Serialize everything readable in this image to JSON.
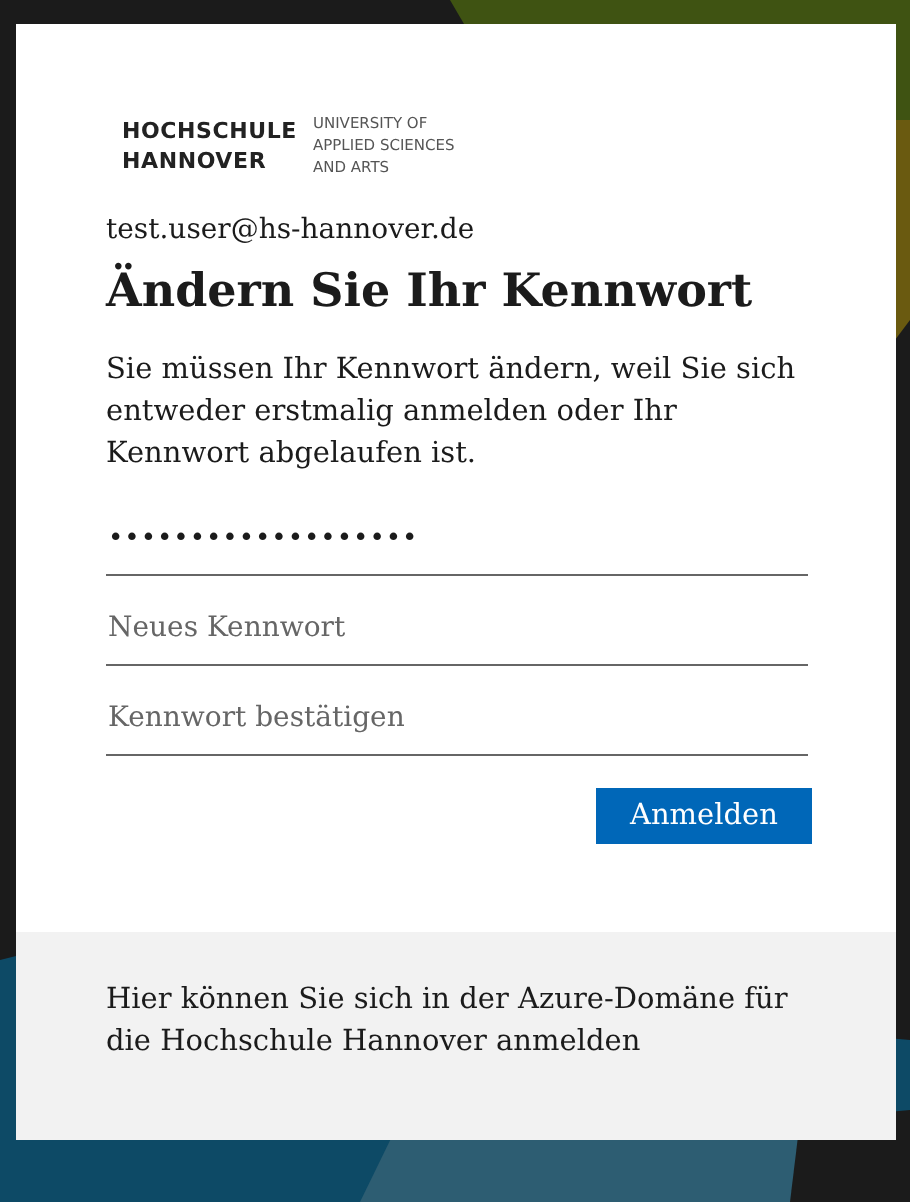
{
  "logo": {
    "name_lines": [
      "HOCHSCHULE",
      "HANNOVER"
    ],
    "tagline_lines": [
      "UNIVERSITY OF",
      "APPLIED SCIENCES",
      "AND ARTS"
    ]
  },
  "account": "test.user@hs-hannover.de",
  "title": "Ändern Sie Ihr Kennwort",
  "description": "Sie müssen Ihr Kennwort ändern, weil Sie sich entweder erstmalig anmelden oder Ihr Kennwort abgelaufen ist.",
  "fields": [
    {
      "value": "•••••••••••••••••••"
    },
    {
      "placeholder": "Neues Kennwort"
    },
    {
      "placeholder": "Kennwort bestätigen"
    }
  ],
  "submit_button": "Anmelden",
  "footer": "Hier können Sie sich in der Azure-Domäne für die Hochschule Hannover anmelden"
}
